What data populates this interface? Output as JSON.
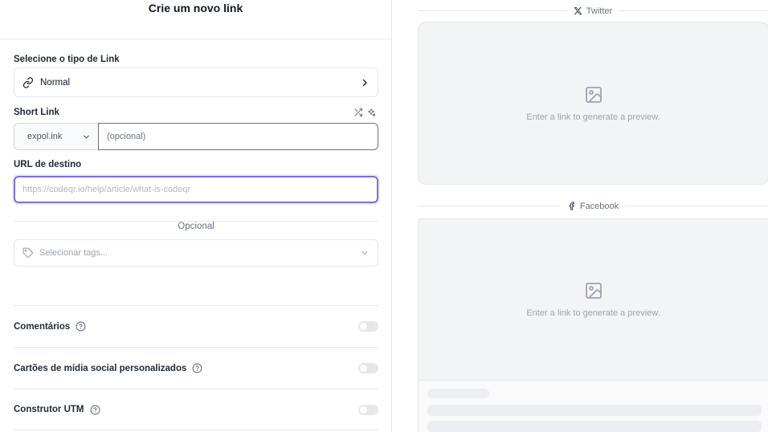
{
  "header": {
    "title": "Crie um novo link"
  },
  "link_type": {
    "label": "Selecione o tipo de Link",
    "value": "Normal",
    "icon": "link-icon"
  },
  "short_link": {
    "label": "Short Link",
    "domain": "expol.ink",
    "slug_placeholder": "(opcional)",
    "tools": [
      "shuffle-icon",
      "sparkles-icon"
    ]
  },
  "destination": {
    "label": "URL de destino",
    "placeholder": "https://codeqr.io/help/article/what-is-codeqr"
  },
  "optional_divider": "Opcional",
  "tags": {
    "placeholder": "Selecionar tags...",
    "icon": "tag-icon"
  },
  "settings": [
    {
      "label": "Comentários",
      "enabled": false
    },
    {
      "label": "Cartões de mídia social personalizados",
      "enabled": false
    },
    {
      "label": "Construtor UTM",
      "enabled": false
    }
  ],
  "preview": {
    "twitter_label": "Twitter",
    "twitter_placeholder": "Enter a link to generate a preview.",
    "facebook_label": "Facebook",
    "facebook_placeholder": "Enter a link to generate a preview."
  },
  "colors": {
    "focus_ring": "#7c6fd6",
    "card_bg": "#f3f4f6",
    "border": "#e5e7eb"
  }
}
